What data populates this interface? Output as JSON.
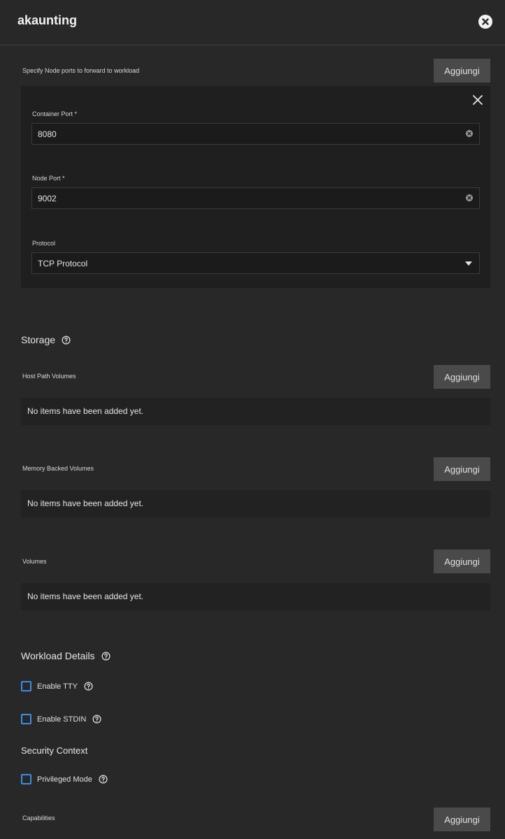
{
  "header": {
    "title": "akaunting",
    "close_icon": "close-circle-icon"
  },
  "node_ports": {
    "label": "Specify Node ports to forward to workload",
    "add_label": "Aggiungi",
    "item": {
      "container_port": {
        "label": "Container Port *",
        "value": "8080"
      },
      "node_port": {
        "label": "Node Port *",
        "value": "9002"
      },
      "protocol": {
        "label": "Protocol",
        "value": "TCP Protocol"
      }
    }
  },
  "storage": {
    "heading": "Storage",
    "host_path": {
      "label": "Host Path Volumes",
      "add_label": "Aggiungi",
      "empty": "No items have been added yet."
    },
    "memory_backed": {
      "label": "Memory Backed Volumes",
      "add_label": "Aggiungi",
      "empty": "No items have been added yet."
    },
    "volumes": {
      "label": "Volumes",
      "add_label": "Aggiungi",
      "empty": "No items have been added yet."
    }
  },
  "workload": {
    "heading": "Workload Details",
    "enable_tty": "Enable TTY",
    "enable_stdin": "Enable STDIN",
    "security_heading": "Security Context",
    "privileged_mode": "Privileged Mode",
    "capabilities": {
      "label": "Capabilities",
      "add_label": "Aggiungi"
    }
  },
  "colors": {
    "background": "#282828",
    "accent": "#3a8ee6",
    "button": "#4a4a4a"
  }
}
